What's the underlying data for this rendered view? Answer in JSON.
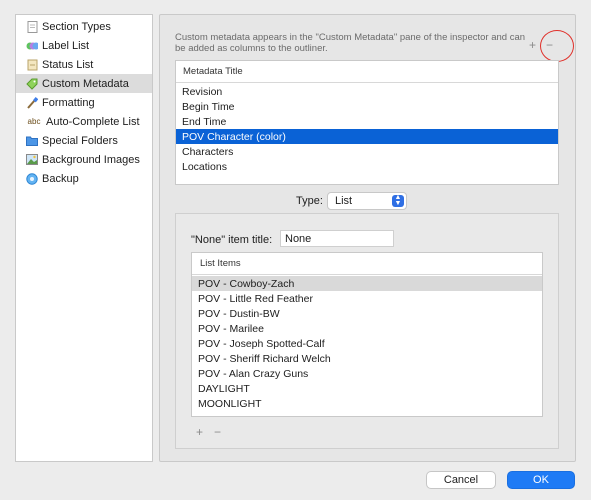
{
  "sidebar": {
    "items": [
      {
        "label": "Section Types",
        "icon": "document-icon",
        "selected": false
      },
      {
        "label": "Label List",
        "icon": "label-icon",
        "selected": false
      },
      {
        "label": "Status List",
        "icon": "status-icon",
        "selected": false
      },
      {
        "label": "Custom Metadata",
        "icon": "tag-icon",
        "selected": true
      },
      {
        "label": "Formatting",
        "icon": "paintbrush-icon",
        "selected": false
      },
      {
        "label": "Auto-Complete List",
        "icon": "abc-icon",
        "selected": false
      },
      {
        "label": "Special Folders",
        "icon": "folder-icon",
        "selected": false
      },
      {
        "label": "Background Images",
        "icon": "image-icon",
        "selected": false
      },
      {
        "label": "Backup",
        "icon": "backup-icon",
        "selected": false
      }
    ]
  },
  "description": "Custom metadata appears in the \"Custom Metadata\" pane of the inspector and can be added as columns to the outliner.",
  "metadata_table": {
    "header": "Metadata Title",
    "rows": [
      "Revision",
      "Begin Time",
      "End Time",
      "POV Character (color)",
      "Characters",
      "Locations"
    ],
    "selected_index": 3,
    "add_label": "+",
    "remove_label": "−"
  },
  "type": {
    "label": "Type:",
    "value": "List"
  },
  "none_item": {
    "label": "\"None\" item title:",
    "value": "None"
  },
  "list_items": {
    "header": "List Items",
    "rows": [
      "POV - Cowboy-Zach",
      "POV - Little Red Feather",
      "POV - Dustin-BW",
      "POV - Marilee",
      "POV - Joseph Spotted-Calf",
      "POV - Sheriff Richard Welch",
      "POV - Alan Crazy Guns",
      "DAYLIGHT",
      "MOONLIGHT"
    ],
    "selected_index": 0,
    "add_label": "+",
    "remove_label": "−"
  },
  "buttons": {
    "cancel": "Cancel",
    "ok": "OK"
  },
  "colors": {
    "selection_blue": "#0a62d6",
    "ok_blue": "#1f7bf5",
    "annotation_red": "#e0302a"
  }
}
